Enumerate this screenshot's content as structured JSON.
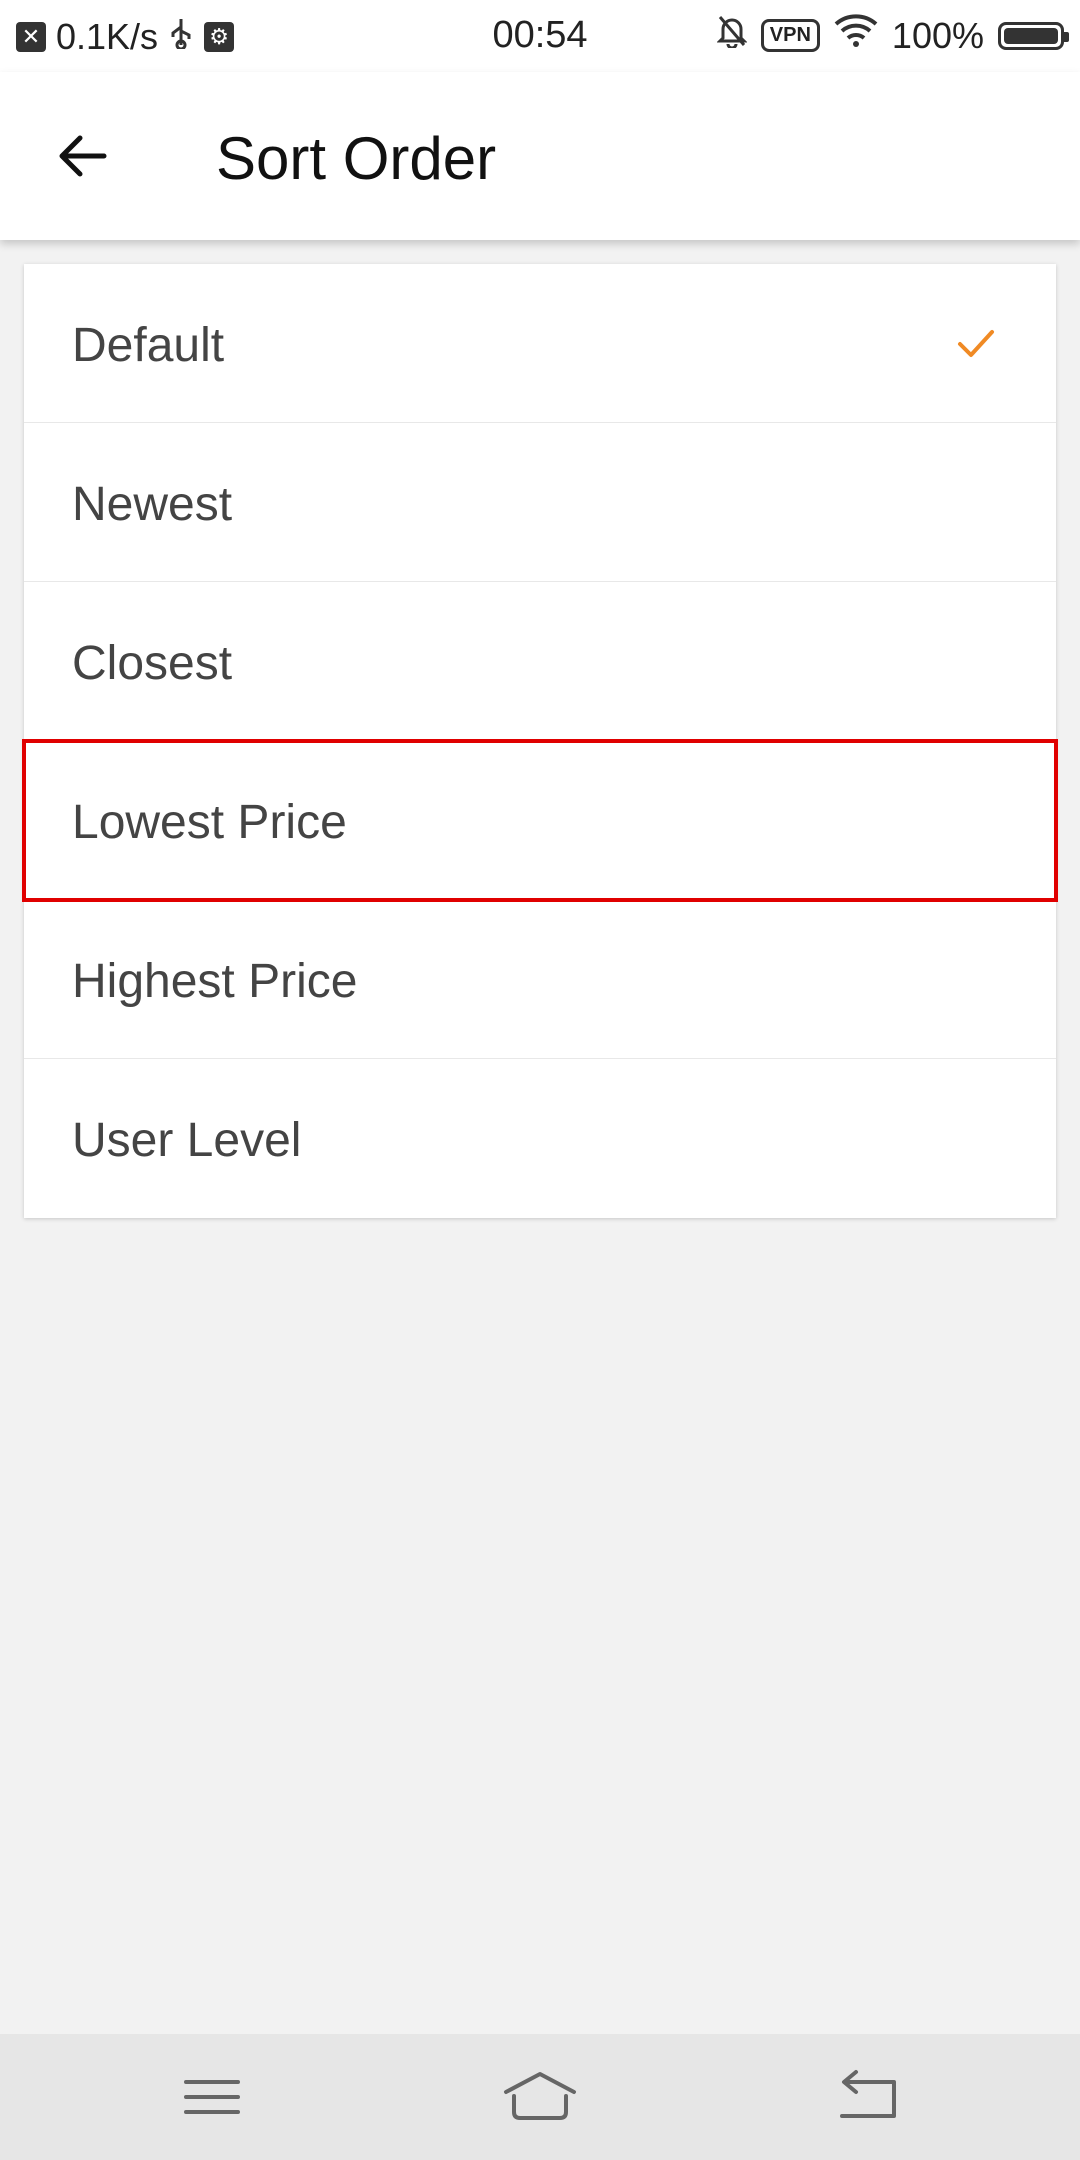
{
  "status_bar": {
    "net_speed": "0.1K/s",
    "time": "00:54",
    "vpn_label": "VPN",
    "battery": "100%"
  },
  "app_bar": {
    "title": "Sort Order",
    "back_icon": "arrow-left-icon"
  },
  "sort_options": [
    {
      "label": "Default",
      "selected": true
    },
    {
      "label": "Newest",
      "selected": false
    },
    {
      "label": "Closest",
      "selected": false
    },
    {
      "label": "Lowest Price",
      "selected": false
    },
    {
      "label": "Highest Price",
      "selected": false
    },
    {
      "label": "User Level",
      "selected": false
    }
  ],
  "colors": {
    "accent": "#f08a24",
    "highlight_border": "#e00000",
    "background": "#f2f2f2"
  },
  "nav_bar": {
    "menu_icon": "menu-icon",
    "home_icon": "home-icon",
    "back_icon": "back-icon"
  }
}
